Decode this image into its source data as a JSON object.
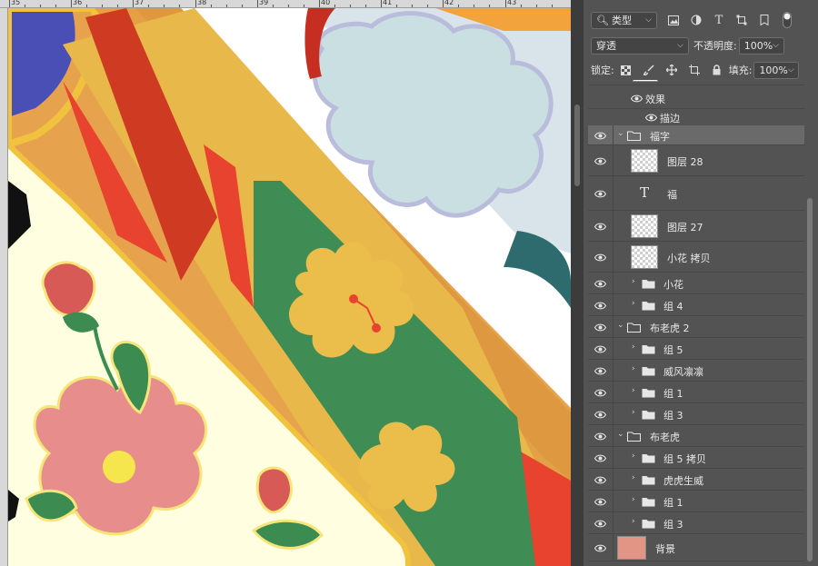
{
  "ruler": {
    "labels": [
      "35",
      "36",
      "37",
      "38",
      "39",
      "40",
      "41",
      "42",
      "43"
    ]
  },
  "filter": {
    "kind_label": "类型"
  },
  "blend": {
    "mode": "穿透",
    "opacity_label": "不透明度:",
    "opacity_value": "100%"
  },
  "lock": {
    "label": "锁定:",
    "fill_label": "填充:",
    "fill_value": "100%"
  },
  "icons": {
    "eye": "eye-icon",
    "folder": "folder-icon",
    "search": "search-icon",
    "text_layer": "text-layer-icon"
  },
  "colors": {
    "panel_bg": "#535353",
    "selected_row": "#6a6a6a",
    "background_swatch": "#e39585"
  },
  "layers": [
    {
      "name": "效果",
      "kind": "effect-header"
    },
    {
      "name": "描边",
      "kind": "effect"
    },
    {
      "name": "福字",
      "kind": "group-open",
      "selected": true
    },
    {
      "name": "图层 28",
      "kind": "pixel"
    },
    {
      "name": "福",
      "kind": "text"
    },
    {
      "name": "图层 27",
      "kind": "pixel"
    },
    {
      "name": "小花 拷贝",
      "kind": "pixel"
    },
    {
      "name": "小花",
      "kind": "group"
    },
    {
      "name": "组 4",
      "kind": "group"
    },
    {
      "name": "布老虎 2",
      "kind": "group-open"
    },
    {
      "name": "组 5",
      "kind": "group"
    },
    {
      "name": "威风凛凛",
      "kind": "group"
    },
    {
      "name": "组 1",
      "kind": "group"
    },
    {
      "name": "组 3",
      "kind": "group"
    },
    {
      "name": "布老虎",
      "kind": "group-open"
    },
    {
      "name": "组 5 拷贝",
      "kind": "group"
    },
    {
      "name": "虎虎生威",
      "kind": "group"
    },
    {
      "name": "组 1",
      "kind": "group"
    },
    {
      "name": "组 3",
      "kind": "group"
    },
    {
      "name": "背景",
      "kind": "background"
    }
  ]
}
